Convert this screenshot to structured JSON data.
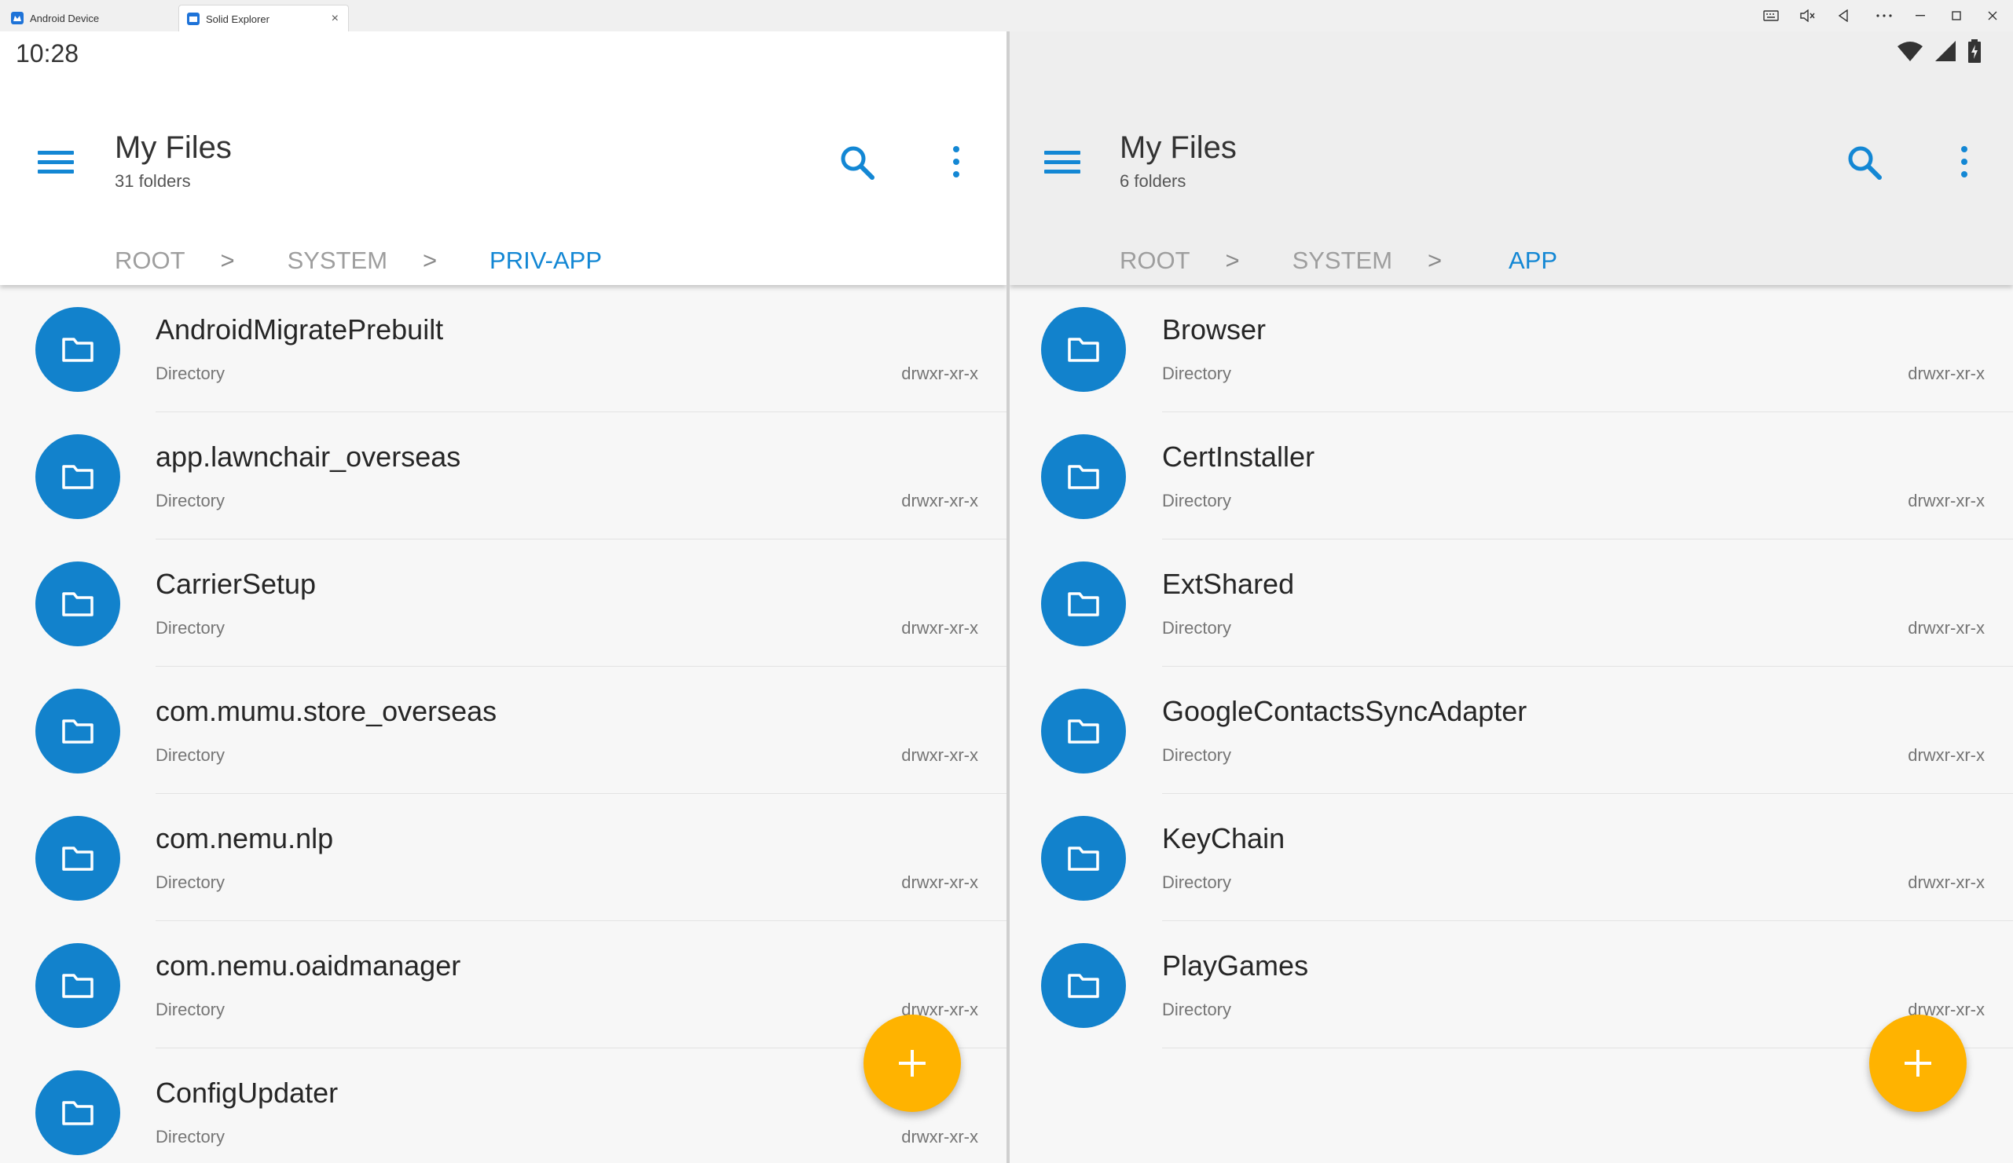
{
  "window": {
    "tabs": [
      {
        "label": "Android Device",
        "active": false
      },
      {
        "label": "Solid Explorer",
        "active": true
      }
    ],
    "close_tab_glyph": "×",
    "controls": [
      "keyboard-icon",
      "mute-icon",
      "back-icon",
      "more-icon",
      "minimize-icon",
      "maximize-icon",
      "close-icon"
    ]
  },
  "status_bar": {
    "time": "10:28",
    "icons": [
      "wifi-icon",
      "signal-icon",
      "battery-charging-icon"
    ]
  },
  "colors": {
    "accent": "#1387d4",
    "folder_circle": "#1282cc",
    "fab": "#ffb300",
    "crumb_inactive": "#9e9e9e"
  },
  "left_pane": {
    "title": "My Files",
    "subtitle": "31 folders",
    "breadcrumbs": [
      {
        "label": "ROOT",
        "active": false
      },
      {
        "label": "SYSTEM",
        "active": false
      },
      {
        "label": "PRIV-APP",
        "active": true
      }
    ],
    "items": [
      {
        "name": "AndroidMigratePrebuilt",
        "type": "Directory",
        "perm": "drwxr-xr-x"
      },
      {
        "name": "app.lawnchair_overseas",
        "type": "Directory",
        "perm": "drwxr-xr-x"
      },
      {
        "name": "CarrierSetup",
        "type": "Directory",
        "perm": "drwxr-xr-x"
      },
      {
        "name": "com.mumu.store_overseas",
        "type": "Directory",
        "perm": "drwxr-xr-x"
      },
      {
        "name": "com.nemu.nlp",
        "type": "Directory",
        "perm": "drwxr-xr-x"
      },
      {
        "name": "com.nemu.oaidmanager",
        "type": "Directory",
        "perm": "drwxr-xr-x"
      },
      {
        "name": "ConfigUpdater",
        "type": "Directory",
        "perm": "drwxr-xr-x"
      }
    ]
  },
  "right_pane": {
    "title": "My Files",
    "subtitle": "6 folders",
    "breadcrumbs": [
      {
        "label": "ROOT",
        "active": false
      },
      {
        "label": "SYSTEM",
        "active": false
      },
      {
        "label": "APP",
        "active": true
      }
    ],
    "items": [
      {
        "name": "Browser",
        "type": "Directory",
        "perm": "drwxr-xr-x"
      },
      {
        "name": "CertInstaller",
        "type": "Directory",
        "perm": "drwxr-xr-x"
      },
      {
        "name": "ExtShared",
        "type": "Directory",
        "perm": "drwxr-xr-x"
      },
      {
        "name": "GoogleContactsSyncAdapter",
        "type": "Directory",
        "perm": "drwxr-xr-x"
      },
      {
        "name": "KeyChain",
        "type": "Directory",
        "perm": "drwxr-xr-x"
      },
      {
        "name": "PlayGames",
        "type": "Directory",
        "perm": "drwxr-xr-x"
      }
    ]
  },
  "chevron_glyph": ">",
  "fab_glyph": "+"
}
